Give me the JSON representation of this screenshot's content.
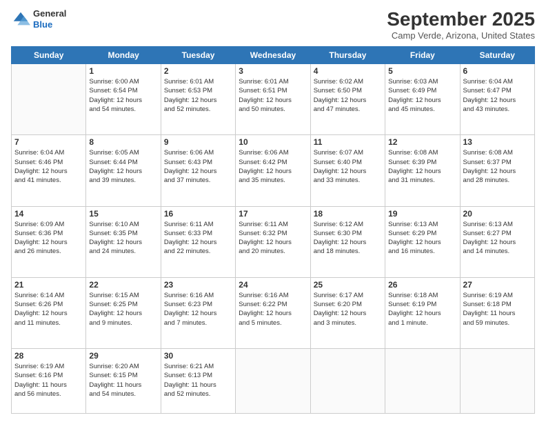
{
  "header": {
    "logo": {
      "general": "General",
      "blue": "Blue"
    },
    "title": "September 2025",
    "location": "Camp Verde, Arizona, United States"
  },
  "weekdays": [
    "Sunday",
    "Monday",
    "Tuesday",
    "Wednesday",
    "Thursday",
    "Friday",
    "Saturday"
  ],
  "weeks": [
    [
      {
        "day": "",
        "info": ""
      },
      {
        "day": "1",
        "info": "Sunrise: 6:00 AM\nSunset: 6:54 PM\nDaylight: 12 hours\nand 54 minutes."
      },
      {
        "day": "2",
        "info": "Sunrise: 6:01 AM\nSunset: 6:53 PM\nDaylight: 12 hours\nand 52 minutes."
      },
      {
        "day": "3",
        "info": "Sunrise: 6:01 AM\nSunset: 6:51 PM\nDaylight: 12 hours\nand 50 minutes."
      },
      {
        "day": "4",
        "info": "Sunrise: 6:02 AM\nSunset: 6:50 PM\nDaylight: 12 hours\nand 47 minutes."
      },
      {
        "day": "5",
        "info": "Sunrise: 6:03 AM\nSunset: 6:49 PM\nDaylight: 12 hours\nand 45 minutes."
      },
      {
        "day": "6",
        "info": "Sunrise: 6:04 AM\nSunset: 6:47 PM\nDaylight: 12 hours\nand 43 minutes."
      }
    ],
    [
      {
        "day": "7",
        "info": "Sunrise: 6:04 AM\nSunset: 6:46 PM\nDaylight: 12 hours\nand 41 minutes."
      },
      {
        "day": "8",
        "info": "Sunrise: 6:05 AM\nSunset: 6:44 PM\nDaylight: 12 hours\nand 39 minutes."
      },
      {
        "day": "9",
        "info": "Sunrise: 6:06 AM\nSunset: 6:43 PM\nDaylight: 12 hours\nand 37 minutes."
      },
      {
        "day": "10",
        "info": "Sunrise: 6:06 AM\nSunset: 6:42 PM\nDaylight: 12 hours\nand 35 minutes."
      },
      {
        "day": "11",
        "info": "Sunrise: 6:07 AM\nSunset: 6:40 PM\nDaylight: 12 hours\nand 33 minutes."
      },
      {
        "day": "12",
        "info": "Sunrise: 6:08 AM\nSunset: 6:39 PM\nDaylight: 12 hours\nand 31 minutes."
      },
      {
        "day": "13",
        "info": "Sunrise: 6:08 AM\nSunset: 6:37 PM\nDaylight: 12 hours\nand 28 minutes."
      }
    ],
    [
      {
        "day": "14",
        "info": "Sunrise: 6:09 AM\nSunset: 6:36 PM\nDaylight: 12 hours\nand 26 minutes."
      },
      {
        "day": "15",
        "info": "Sunrise: 6:10 AM\nSunset: 6:35 PM\nDaylight: 12 hours\nand 24 minutes."
      },
      {
        "day": "16",
        "info": "Sunrise: 6:11 AM\nSunset: 6:33 PM\nDaylight: 12 hours\nand 22 minutes."
      },
      {
        "day": "17",
        "info": "Sunrise: 6:11 AM\nSunset: 6:32 PM\nDaylight: 12 hours\nand 20 minutes."
      },
      {
        "day": "18",
        "info": "Sunrise: 6:12 AM\nSunset: 6:30 PM\nDaylight: 12 hours\nand 18 minutes."
      },
      {
        "day": "19",
        "info": "Sunrise: 6:13 AM\nSunset: 6:29 PM\nDaylight: 12 hours\nand 16 minutes."
      },
      {
        "day": "20",
        "info": "Sunrise: 6:13 AM\nSunset: 6:27 PM\nDaylight: 12 hours\nand 14 minutes."
      }
    ],
    [
      {
        "day": "21",
        "info": "Sunrise: 6:14 AM\nSunset: 6:26 PM\nDaylight: 12 hours\nand 11 minutes."
      },
      {
        "day": "22",
        "info": "Sunrise: 6:15 AM\nSunset: 6:25 PM\nDaylight: 12 hours\nand 9 minutes."
      },
      {
        "day": "23",
        "info": "Sunrise: 6:16 AM\nSunset: 6:23 PM\nDaylight: 12 hours\nand 7 minutes."
      },
      {
        "day": "24",
        "info": "Sunrise: 6:16 AM\nSunset: 6:22 PM\nDaylight: 12 hours\nand 5 minutes."
      },
      {
        "day": "25",
        "info": "Sunrise: 6:17 AM\nSunset: 6:20 PM\nDaylight: 12 hours\nand 3 minutes."
      },
      {
        "day": "26",
        "info": "Sunrise: 6:18 AM\nSunset: 6:19 PM\nDaylight: 12 hours\nand 1 minute."
      },
      {
        "day": "27",
        "info": "Sunrise: 6:19 AM\nSunset: 6:18 PM\nDaylight: 11 hours\nand 59 minutes."
      }
    ],
    [
      {
        "day": "28",
        "info": "Sunrise: 6:19 AM\nSunset: 6:16 PM\nDaylight: 11 hours\nand 56 minutes."
      },
      {
        "day": "29",
        "info": "Sunrise: 6:20 AM\nSunset: 6:15 PM\nDaylight: 11 hours\nand 54 minutes."
      },
      {
        "day": "30",
        "info": "Sunrise: 6:21 AM\nSunset: 6:13 PM\nDaylight: 11 hours\nand 52 minutes."
      },
      {
        "day": "",
        "info": ""
      },
      {
        "day": "",
        "info": ""
      },
      {
        "day": "",
        "info": ""
      },
      {
        "day": "",
        "info": ""
      }
    ]
  ]
}
